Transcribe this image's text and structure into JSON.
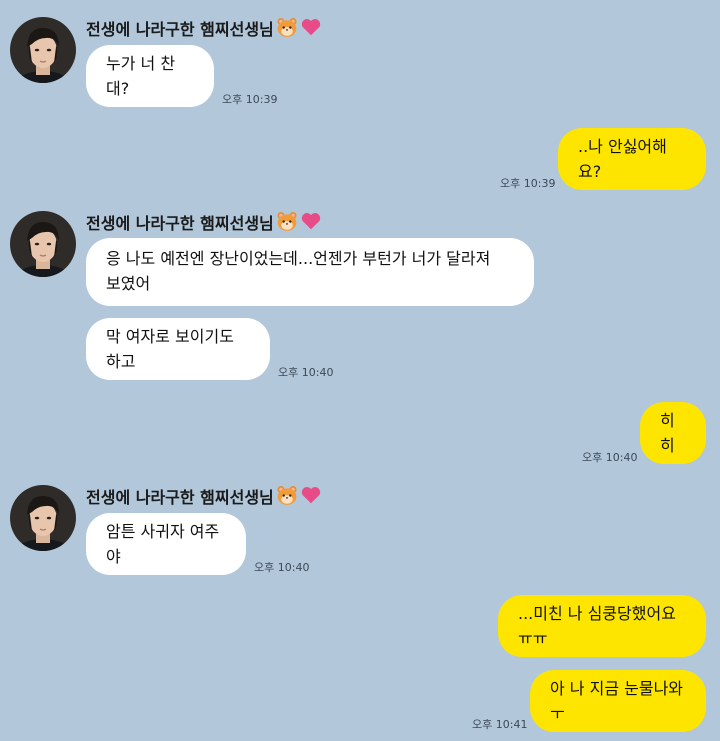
{
  "theme": {
    "background": "#b2c7da",
    "incoming_bubble": "#ffffff",
    "outgoing_bubble": "#fee500"
  },
  "sender_name": "전생에 나라구한 햄찌선생님",
  "sender_emojis": [
    "hamster-face-icon",
    "pink-heart-icon"
  ],
  "messages": [
    {
      "from": "them",
      "text": "누가 너 찬대?",
      "time": "오후 10:39"
    },
    {
      "from": "me",
      "text": "..나 안싫어해요?",
      "time": "오후 10:39"
    },
    {
      "from": "them",
      "lines": [
        "응 나도 예전엔 장난이었는데...언젠가 부턴가 너가 달라져",
        "보였어"
      ]
    },
    {
      "from": "them",
      "text": "막 여자로 보이기도 하고",
      "time": "오후 10:40"
    },
    {
      "from": "me",
      "text": "히히",
      "time": "오후 10:40"
    },
    {
      "from": "them",
      "text": "암튼 사귀자 여주야",
      "time": "오후 10:40"
    },
    {
      "from": "me",
      "text": "...미친 나 심쿵당했어요ㅠㅠ"
    },
    {
      "from": "me",
      "text": "아 나 지금 눈물나와ㅜ",
      "time": "오후 10:41"
    }
  ]
}
